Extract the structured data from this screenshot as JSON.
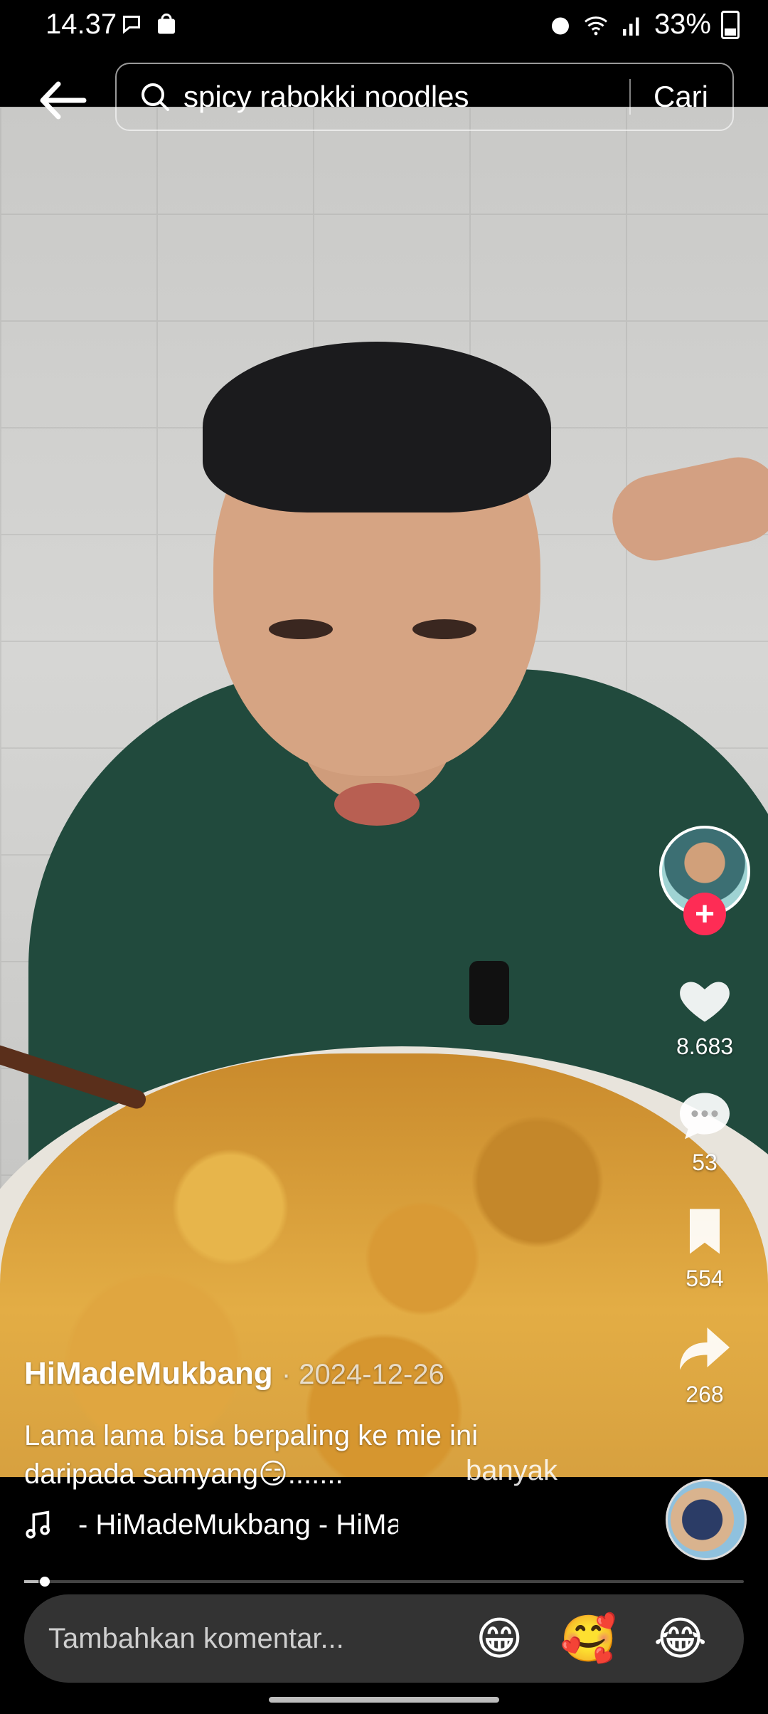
{
  "status_bar": {
    "time": "14.37",
    "battery": "33%",
    "icons": [
      "chat-bubble-icon",
      "shop-bag-icon",
      "alarm-icon",
      "wifi-icon",
      "signal-icon",
      "battery-icon"
    ]
  },
  "search": {
    "query": "spicy rabokki noodles",
    "submit_label": "Cari"
  },
  "actions": {
    "likes": "8.683",
    "comments": "53",
    "bookmarks": "554",
    "shares": "268"
  },
  "post": {
    "author": "HiMadeMukbang",
    "date": "· 2024-12-26",
    "caption_line1": "Lama lama bisa berpaling ke mie ini",
    "caption_line2": "daripada samyang😏.......",
    "more_label": "banyak"
  },
  "music": {
    "text": "- HiMadeMukbang - HiMadeMukbang"
  },
  "progress": {
    "fraction": 0.02
  },
  "comment": {
    "placeholder": "Tambahkan komentar...",
    "emojis": [
      "😁",
      "🥰",
      "😂"
    ]
  },
  "colors": {
    "accent": "#fe2c55",
    "bar_bg": "#333333"
  }
}
